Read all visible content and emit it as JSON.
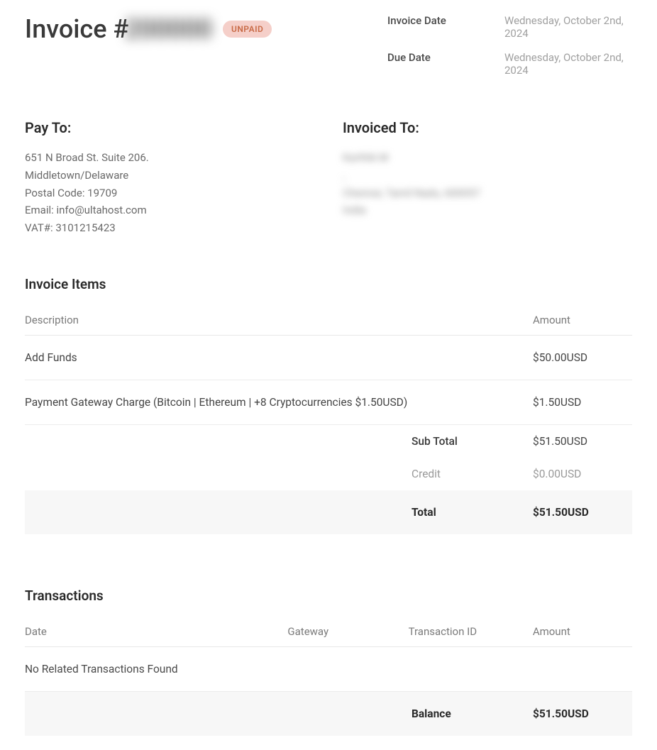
{
  "header": {
    "title_prefix": "Invoice #",
    "invoice_number": "200000",
    "status_badge": "UNPAID"
  },
  "dates": {
    "invoice_date_label": "Invoice Date",
    "invoice_date_value": "Wednesday, October 2nd, 2024",
    "due_date_label": "Due Date",
    "due_date_value": "Wednesday, October 2nd, 2024"
  },
  "pay_to": {
    "title": "Pay To:",
    "line1": "651 N Broad St. Suite 206.",
    "line2": "Middletown/Delaware",
    "line3": "Postal Code: 19709",
    "line4": "Email: info@ultahost.com",
    "line5": "VAT#: 3101215423"
  },
  "invoiced_to": {
    "title": "Invoiced To:",
    "line1": "Karthik M",
    "line2": ",",
    "line3": "Chennai, Tamil Nadu, 600057",
    "line4": "India"
  },
  "items": {
    "title": "Invoice Items",
    "columns": {
      "description": "Description",
      "amount": "Amount"
    },
    "rows": [
      {
        "description": "Add Funds",
        "amount": "$50.00USD"
      },
      {
        "description": "Payment Gateway Charge (Bitcoin | Ethereum | +8 Cryptocurrencies $1.50USD)",
        "amount": "$1.50USD"
      }
    ],
    "subtotal_label": "Sub Total",
    "subtotal_value": "$51.50USD",
    "credit_label": "Credit",
    "credit_value": "$0.00USD",
    "total_label": "Total",
    "total_value": "$51.50USD"
  },
  "transactions": {
    "title": "Transactions",
    "columns": {
      "date": "Date",
      "gateway": "Gateway",
      "txid": "Transaction ID",
      "amount": "Amount"
    },
    "empty_message": "No Related Transactions Found",
    "balance_label": "Balance",
    "balance_value": "$51.50USD"
  }
}
